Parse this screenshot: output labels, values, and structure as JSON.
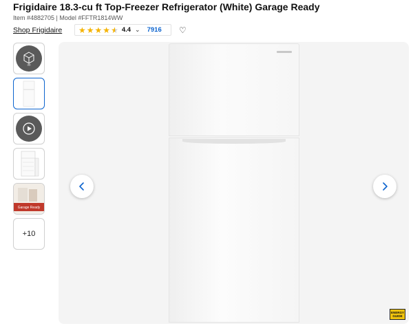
{
  "product": {
    "title": "Frigidaire 18.3-cu ft Top-Freezer Refrigerator (White) Garage Ready",
    "meta": "Item #4882705 | Model #FFTR1814WW",
    "shop_link": "Shop Frigidaire",
    "rating": "4.4",
    "rating_stars": 4.5,
    "review_count": "7916"
  },
  "thumbnails": [
    {
      "name": "3d-view",
      "label": "3D"
    },
    {
      "name": "front-image",
      "label": ""
    },
    {
      "name": "video",
      "label": ""
    },
    {
      "name": "interior-image",
      "label": ""
    },
    {
      "name": "garage-ready-image",
      "label": "Garage Ready"
    },
    {
      "name": "more-images",
      "label": "+10"
    }
  ],
  "badge": {
    "energy_guide": "ENERGY GUIDE"
  },
  "colors": {
    "accent": "#0b63ce",
    "star": "#f5b301",
    "energy_badge": "#f1c40f"
  }
}
